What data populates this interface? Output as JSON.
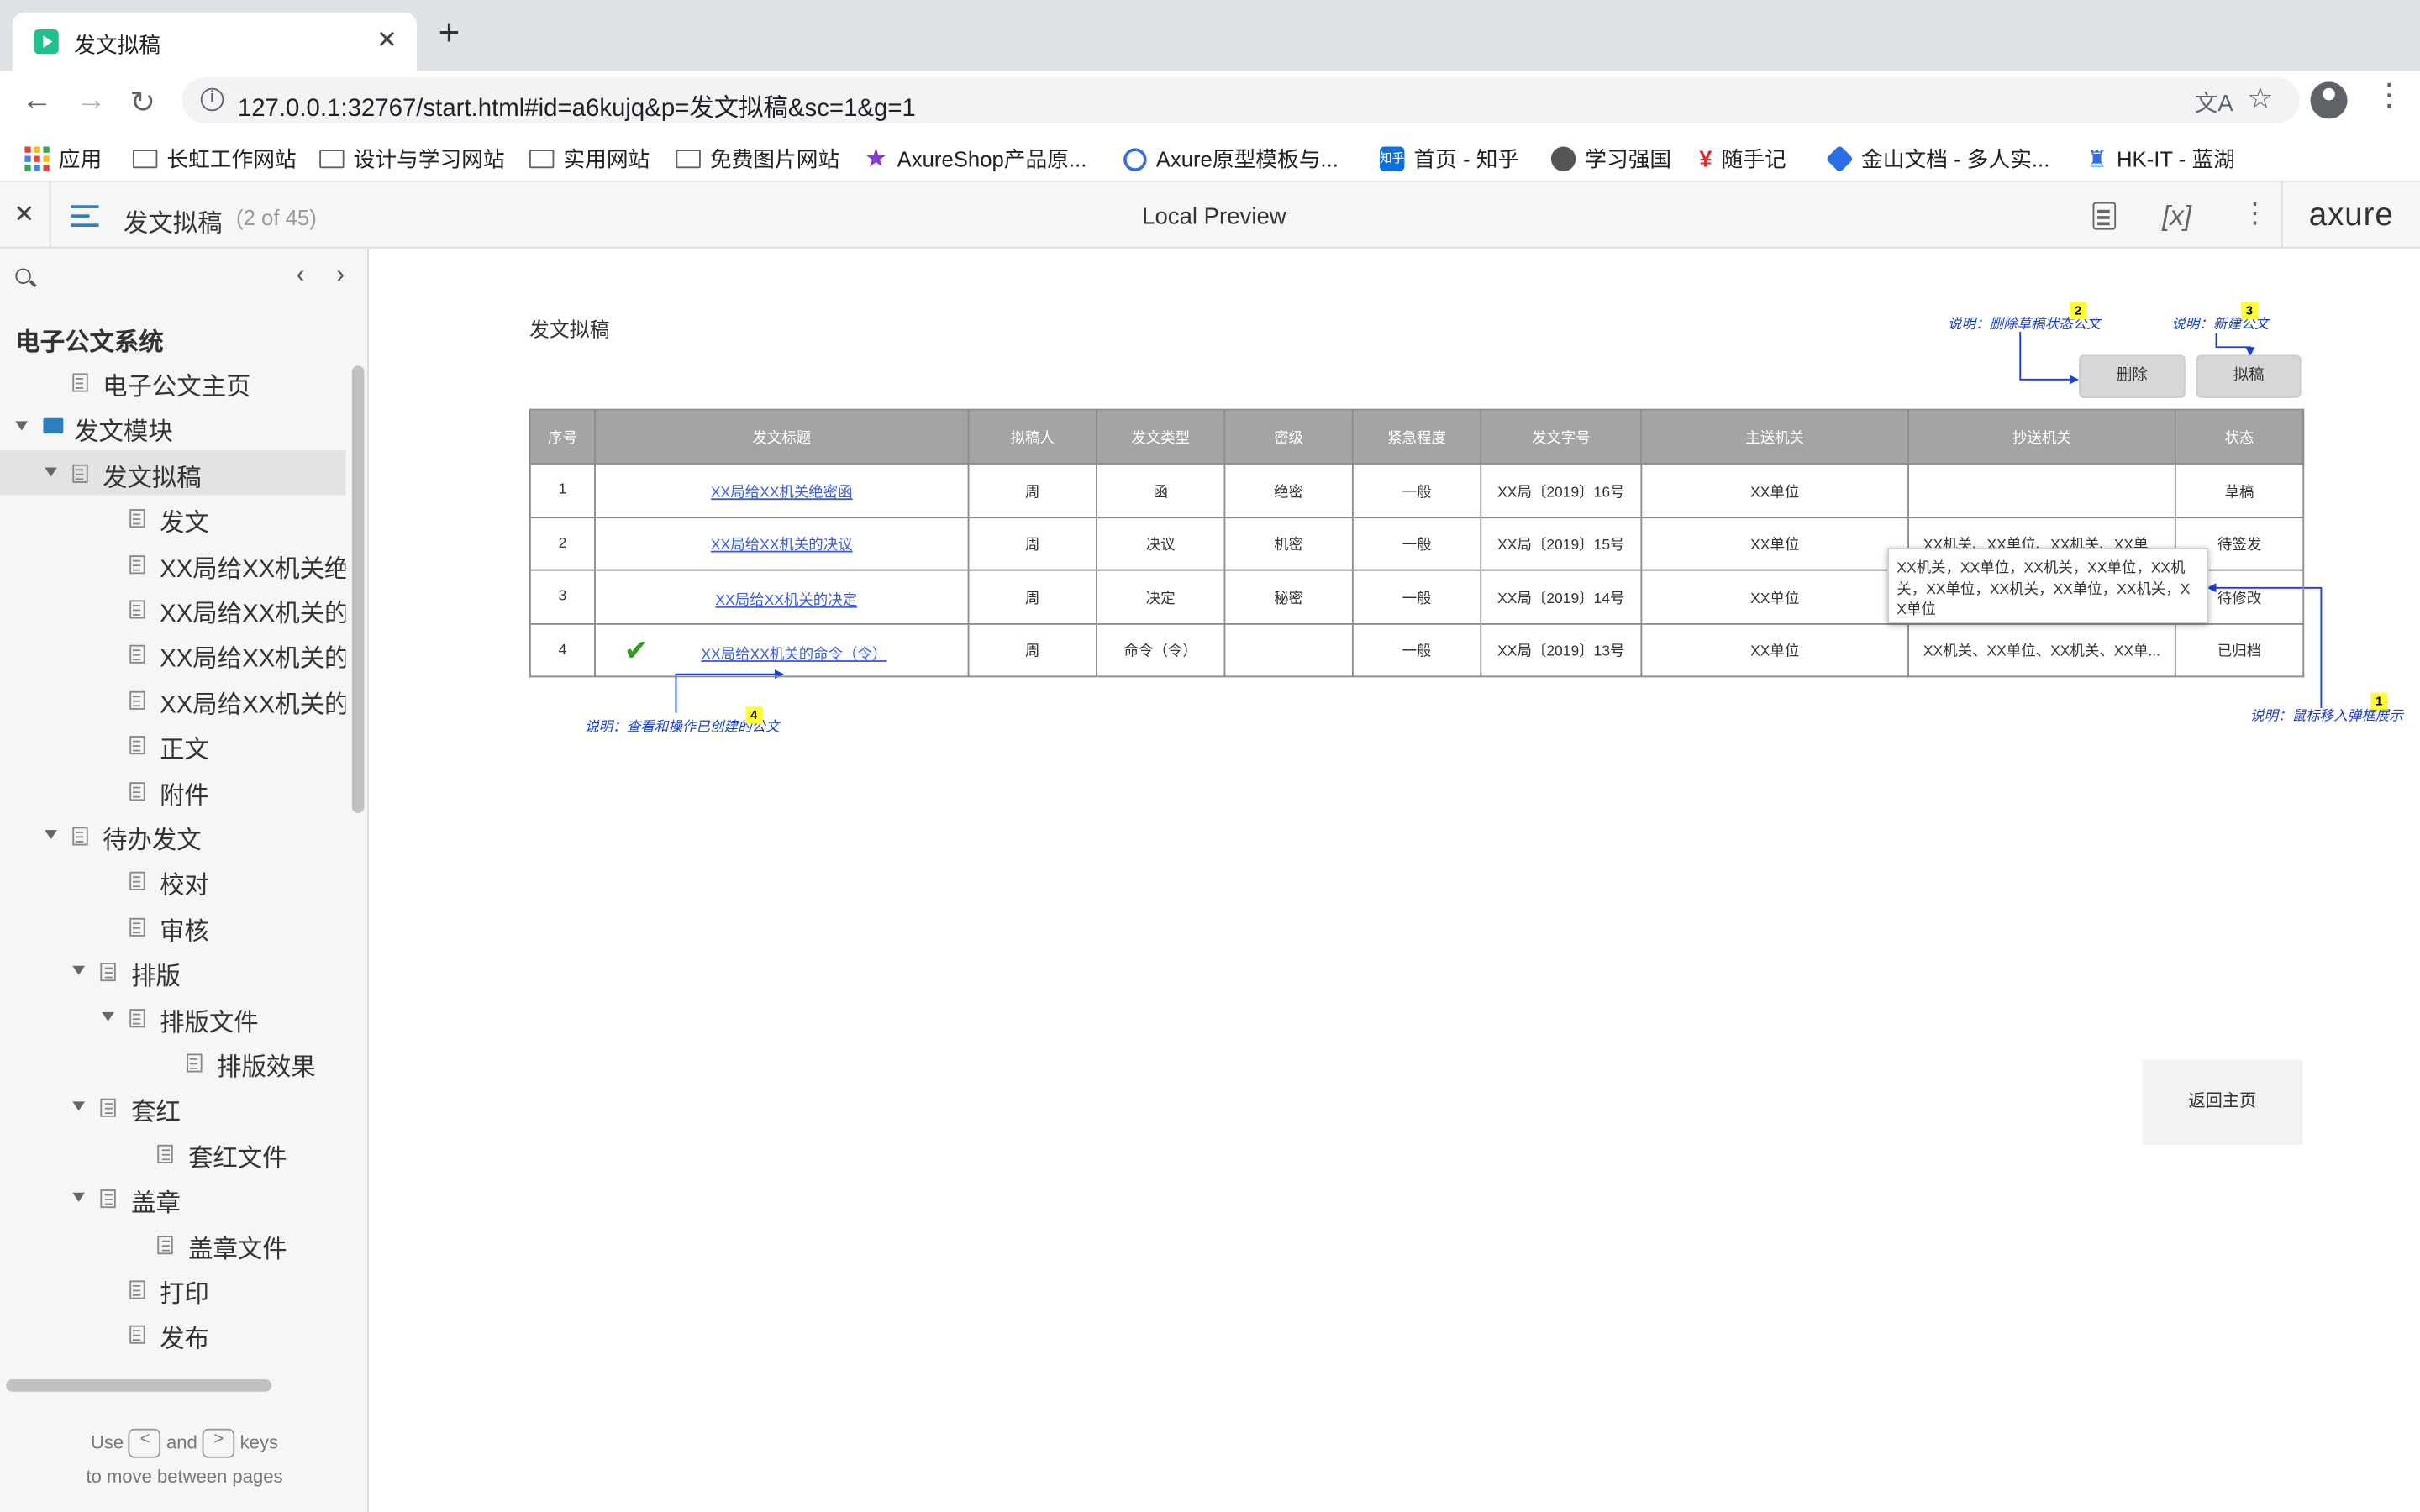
{
  "browser": {
    "tab_title": "发文拟稿",
    "new_tab": "+",
    "url": "127.0.0.1:32767/start.html#id=a6kujq&p=发文拟稿&sc=1&g=1",
    "bookmarks": [
      "应用",
      "长虹工作网站",
      "设计与学习网站",
      "实用网站",
      "免费图片网站",
      "AxureShop产品原...",
      "Axure原型模板与...",
      "首页 - 知乎",
      "学习强国",
      "随手记",
      "金山文档 - 多人实...",
      "HK-IT - 蓝湖"
    ]
  },
  "axure": {
    "page_title": "发文拟稿",
    "page_count": "(2 of 45)",
    "preview_label": "Local Preview",
    "logo": "axure"
  },
  "sidebar": {
    "project": "电子公文系统",
    "tree": [
      {
        "label": "电子公文主页",
        "level": 1,
        "type": "page"
      },
      {
        "label": "发文模块",
        "level": 0,
        "type": "folder",
        "expanded": true
      },
      {
        "label": "发文拟稿",
        "level": 1,
        "type": "page",
        "expanded": true,
        "selected": true
      },
      {
        "label": "发文",
        "level": 3,
        "type": "page"
      },
      {
        "label": "XX局给XX机关绝密函",
        "level": 3,
        "type": "page"
      },
      {
        "label": "XX局给XX机关的决议",
        "level": 3,
        "type": "page"
      },
      {
        "label": "XX局给XX机关的决定",
        "level": 3,
        "type": "page"
      },
      {
        "label": "XX局给XX机关的命令",
        "level": 3,
        "type": "page"
      },
      {
        "label": "正文",
        "level": 3,
        "type": "page"
      },
      {
        "label": "附件",
        "level": 3,
        "type": "page"
      },
      {
        "label": "待办发文",
        "level": 1,
        "type": "page",
        "expanded": true
      },
      {
        "label": "校对",
        "level": 3,
        "type": "page"
      },
      {
        "label": "审核",
        "level": 3,
        "type": "page"
      },
      {
        "label": "排版",
        "level": 2,
        "type": "page",
        "expanded": true
      },
      {
        "label": "排版文件",
        "level": 3,
        "type": "page",
        "expanded": true
      },
      {
        "label": "排版效果",
        "level": 5,
        "type": "page"
      },
      {
        "label": "套红",
        "level": 2,
        "type": "page",
        "expanded": true
      },
      {
        "label": "套红文件",
        "level": 4,
        "type": "page"
      },
      {
        "label": "盖章",
        "level": 2,
        "type": "page",
        "expanded": true
      },
      {
        "label": "盖章文件",
        "level": 4,
        "type": "page"
      },
      {
        "label": "打印",
        "level": 3,
        "type": "page"
      },
      {
        "label": "发布",
        "level": 3,
        "type": "page"
      }
    ],
    "hint_use": "Use",
    "hint_and": "and",
    "hint_keys": "keys",
    "hint_line2": "to move between pages",
    "key_prev": "<",
    "key_next": ">"
  },
  "content": {
    "heading": "发文拟稿",
    "notes": {
      "delete_note": "说明：删除草稿状态公文",
      "delete_badge": "2",
      "new_note": "说明：新建公文",
      "new_badge": "3",
      "hover_note": "说明：鼠标移入弹框展示",
      "hover_badge": "1",
      "view_note": "说明：查看和操作已创建的公文",
      "view_badge": "4"
    },
    "buttons": {
      "delete": "删除",
      "draft": "拟稿",
      "home": "返回主页"
    },
    "table": {
      "headers": [
        "序号",
        "发文标题",
        "拟稿人",
        "发文类型",
        "密级",
        "紧急程度",
        "发文字号",
        "主送机关",
        "抄送机关",
        "状态"
      ],
      "rows": [
        {
          "no": "1",
          "title": "XX局给XX机关绝密函",
          "author": "周",
          "type": "函",
          "secret": "绝密",
          "urgency": "一般",
          "number": "XX局〔2019〕16号",
          "main": "XX单位",
          "cc": "",
          "status": "草稿"
        },
        {
          "no": "2",
          "title": "XX局给XX机关的决议",
          "author": "周",
          "type": "决议",
          "secret": "机密",
          "urgency": "一般",
          "number": "XX局〔2019〕15号",
          "main": "XX单位",
          "cc": "XX机关、XX单位、XX机关、XX单...",
          "status": "待签发"
        },
        {
          "no": "3",
          "title": "XX局给XX机关的决定",
          "author": "周",
          "type": "决定",
          "secret": "秘密",
          "urgency": "一般",
          "number": "XX局〔2019〕14号",
          "main": "XX单位",
          "cc": "",
          "status": "待修改"
        },
        {
          "no": "4",
          "title": "XX局给XX机关的命令（令）",
          "author": "周",
          "type": "命令（令）",
          "secret": "",
          "urgency": "一般",
          "number": "XX局〔2019〕13号",
          "main": "XX单位",
          "cc": "XX机关、XX单位、XX机关、XX单...",
          "status": "已归档"
        }
      ]
    },
    "tooltip": "XX机关，XX单位，XX机关，XX单位，XX机关，XX单位，XX机关，XX单位，XX机关，XX单位"
  }
}
